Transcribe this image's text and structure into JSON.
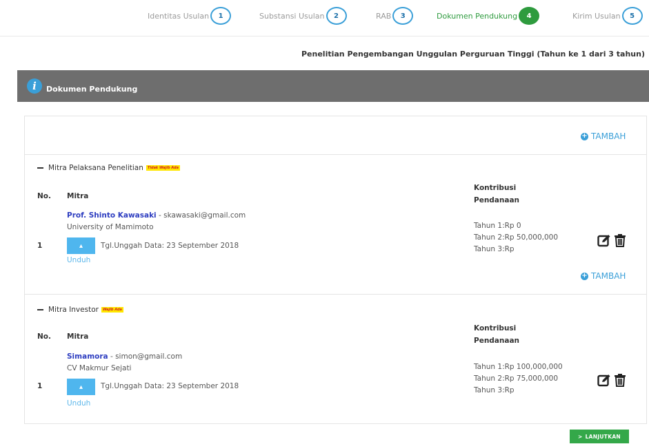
{
  "wizard": {
    "steps": [
      {
        "label": "Identitas Usulan",
        "num": "1"
      },
      {
        "label": "Substansi Usulan",
        "num": "2"
      },
      {
        "label": "RAB",
        "num": "3"
      },
      {
        "label": "Dokumen Pendukung",
        "num": "4"
      },
      {
        "label": "Kirim Usulan",
        "num": "5"
      }
    ],
    "active_step": "4"
  },
  "program_title": "Penelitian Pengembangan Unggulan Perguruan Tinggi (Tahun ke 1 dari 3 tahun)",
  "panel": {
    "title": "Dokumen Pendukung",
    "info_icon": "i"
  },
  "add_label": "TAMBAH",
  "sections": [
    {
      "title": "Mitra Pelaksana Penelitian",
      "badge": "Tidak Wajib Ada",
      "col_no": "No.",
      "col_mitra": "Mitra",
      "col_kontribusi": "Kontribusi Pendanaan",
      "row": {
        "no": "1",
        "name": "Prof. Shinto Kawasaki",
        "email": " - skawasaki@gmail.com",
        "institution": "University of Mamimoto",
        "upload_text": "Tgl.Unggah Data: 23 September 2018",
        "download": "Unduh",
        "kontribusi": [
          "Tahun 1:Rp 0",
          "Tahun 2:Rp 50,000,000",
          "Tahun 3:Rp"
        ]
      }
    },
    {
      "title": "Mitra Investor",
      "badge": "Wajib Ada",
      "col_no": "No.",
      "col_mitra": "Mitra",
      "col_kontribusi": "Kontribusi Pendanaan",
      "row": {
        "no": "1",
        "name": "Simamora",
        "email": " - simon@gmail.com",
        "institution": "CV Makmur Sejati",
        "upload_text": "Tgl.Unggah Data: 23 September 2018",
        "download": "Unduh",
        "kontribusi": [
          "Tahun 1:Rp 100,000,000",
          "Tahun 2:Rp 75,000,000",
          "Tahun 3:Rp"
        ]
      }
    }
  ],
  "next_button": "LANJUTKAN",
  "icons": {
    "info": "info-icon",
    "add": "plus-circle-icon",
    "upload": "upload-icon",
    "edit": "edit-icon",
    "delete": "trash-icon",
    "next": "chevron-right-icon"
  },
  "colors": {
    "accent": "#3a9fd8",
    "active_step": "#2e9b3e",
    "header_bar": "#6e6e6e",
    "next_button": "#34a849",
    "badge_bg": "#ffe600",
    "badge_text": "#d42020",
    "mitra_name": "#2d3dc0"
  }
}
